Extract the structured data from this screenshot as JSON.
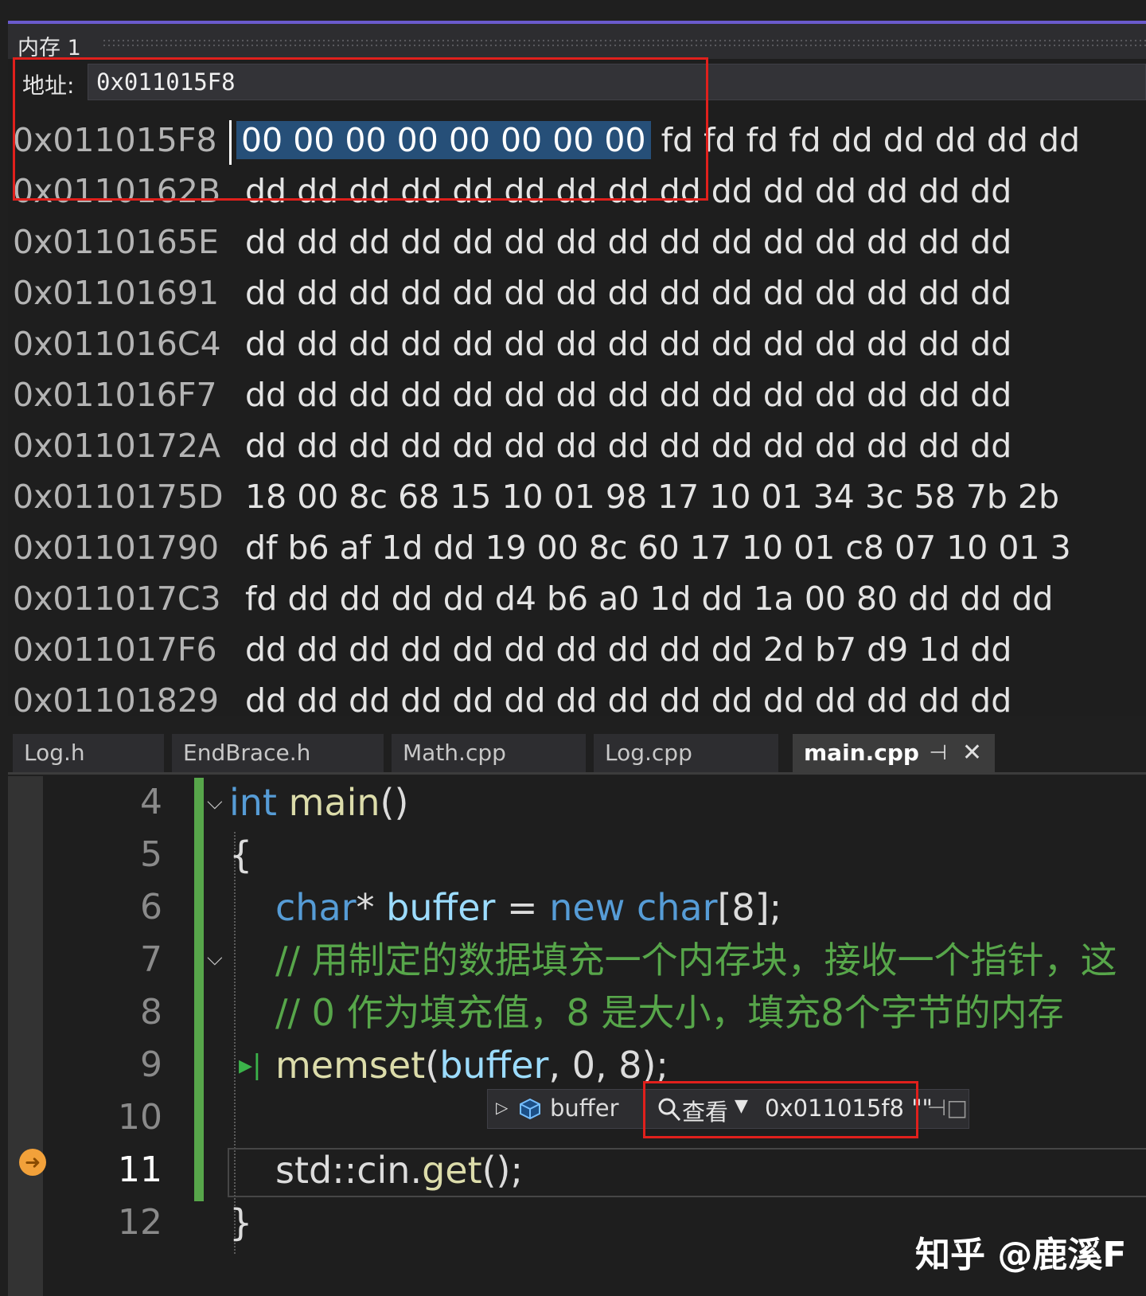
{
  "memory_window": {
    "title": "内存 1",
    "address_label": "地址:",
    "address_value": "0x011015F8",
    "rows": [
      {
        "addr": "0x011015F8",
        "sel": "00 00 00 00 00 00 00 00",
        "bytes": "fd fd fd fd dd dd dd dd dd"
      },
      {
        "addr": "0x0110162B",
        "bytes": "dd dd dd dd dd dd dd dd dd dd dd dd dd dd dd"
      },
      {
        "addr": "0x0110165E",
        "bytes": "dd dd dd dd dd dd dd dd dd dd dd dd dd dd dd"
      },
      {
        "addr": "0x01101691",
        "bytes": "dd dd dd dd dd dd dd dd dd dd dd dd dd dd dd"
      },
      {
        "addr": "0x011016C4",
        "bytes": "dd dd dd dd dd dd dd dd dd dd dd dd dd dd dd"
      },
      {
        "addr": "0x011016F7",
        "bytes": "dd dd dd dd dd dd dd dd dd dd dd dd dd dd dd"
      },
      {
        "addr": "0x0110172A",
        "bytes": "dd dd dd dd dd dd dd dd dd dd dd dd dd dd dd"
      },
      {
        "addr": "0x0110175D",
        "bytes": "18 00 8c 68 15 10 01 98 17 10 01 34 3c 58 7b 2b"
      },
      {
        "addr": "0x01101790",
        "bytes": "df b6 af 1d dd 19 00 8c 60 17 10 01 c8 07 10 01 3"
      },
      {
        "addr": "0x011017C3",
        "bytes": "fd dd dd dd dd d4 b6 a0 1d dd 1a 00 80 dd dd dd"
      },
      {
        "addr": "0x011017F6",
        "bytes": "dd dd dd dd dd dd dd dd dd dd 2d b7 d9 1d dd"
      },
      {
        "addr": "0x01101829",
        "bytes": "dd dd dd dd dd dd dd dd dd dd dd dd dd dd dd"
      }
    ]
  },
  "tabs": [
    {
      "label": "Log.h"
    },
    {
      "label": "EndBrace.h"
    },
    {
      "label": "Math.cpp"
    },
    {
      "label": "Log.cpp"
    },
    {
      "label": "main.cpp",
      "active": true
    }
  ],
  "tab_icons": {
    "pin": "pin-icon",
    "close": "close-icon"
  },
  "editor": {
    "line_numbers": [
      "4",
      "5",
      "6",
      "7",
      "8",
      "9",
      "10",
      "11",
      "12"
    ],
    "current_line": "11",
    "code": {
      "l4_kw": "int",
      "l4_fn": "main",
      "l4_rest": "()",
      "l5": "{",
      "l6_kw1": "char",
      "l6_star": "* ",
      "l6_var": "buffer",
      "l6_eq": " = ",
      "l6_kw2": "new",
      "l6_kw3": "char",
      "l6_rest": "[8];",
      "l7_cmt": "// 用制定的数据填充一个内存块，接收一个指针，这",
      "l8_cmt": "// 0 作为填充值，8 是大小，填充8个字节的内存",
      "l9_fn": "memset",
      "l9_p1": "(",
      "l9_var": "buffer",
      "l9_rest": ", 0, 8);",
      "l11_a": "std::",
      "l11_b": "cin",
      "l11_c": ".",
      "l11_fn": "get",
      "l11_rest": "();",
      "l12": "}"
    }
  },
  "datatip": {
    "name": "buffer",
    "view_label": "查看",
    "value": "0x011015f8 \"\""
  },
  "watermark": "知乎 @鹿溪F",
  "colors": {
    "accent": "#6a5acd",
    "highlight_box": "#e0201c",
    "selection": "#264f78",
    "change_bar": "#57a64a"
  }
}
